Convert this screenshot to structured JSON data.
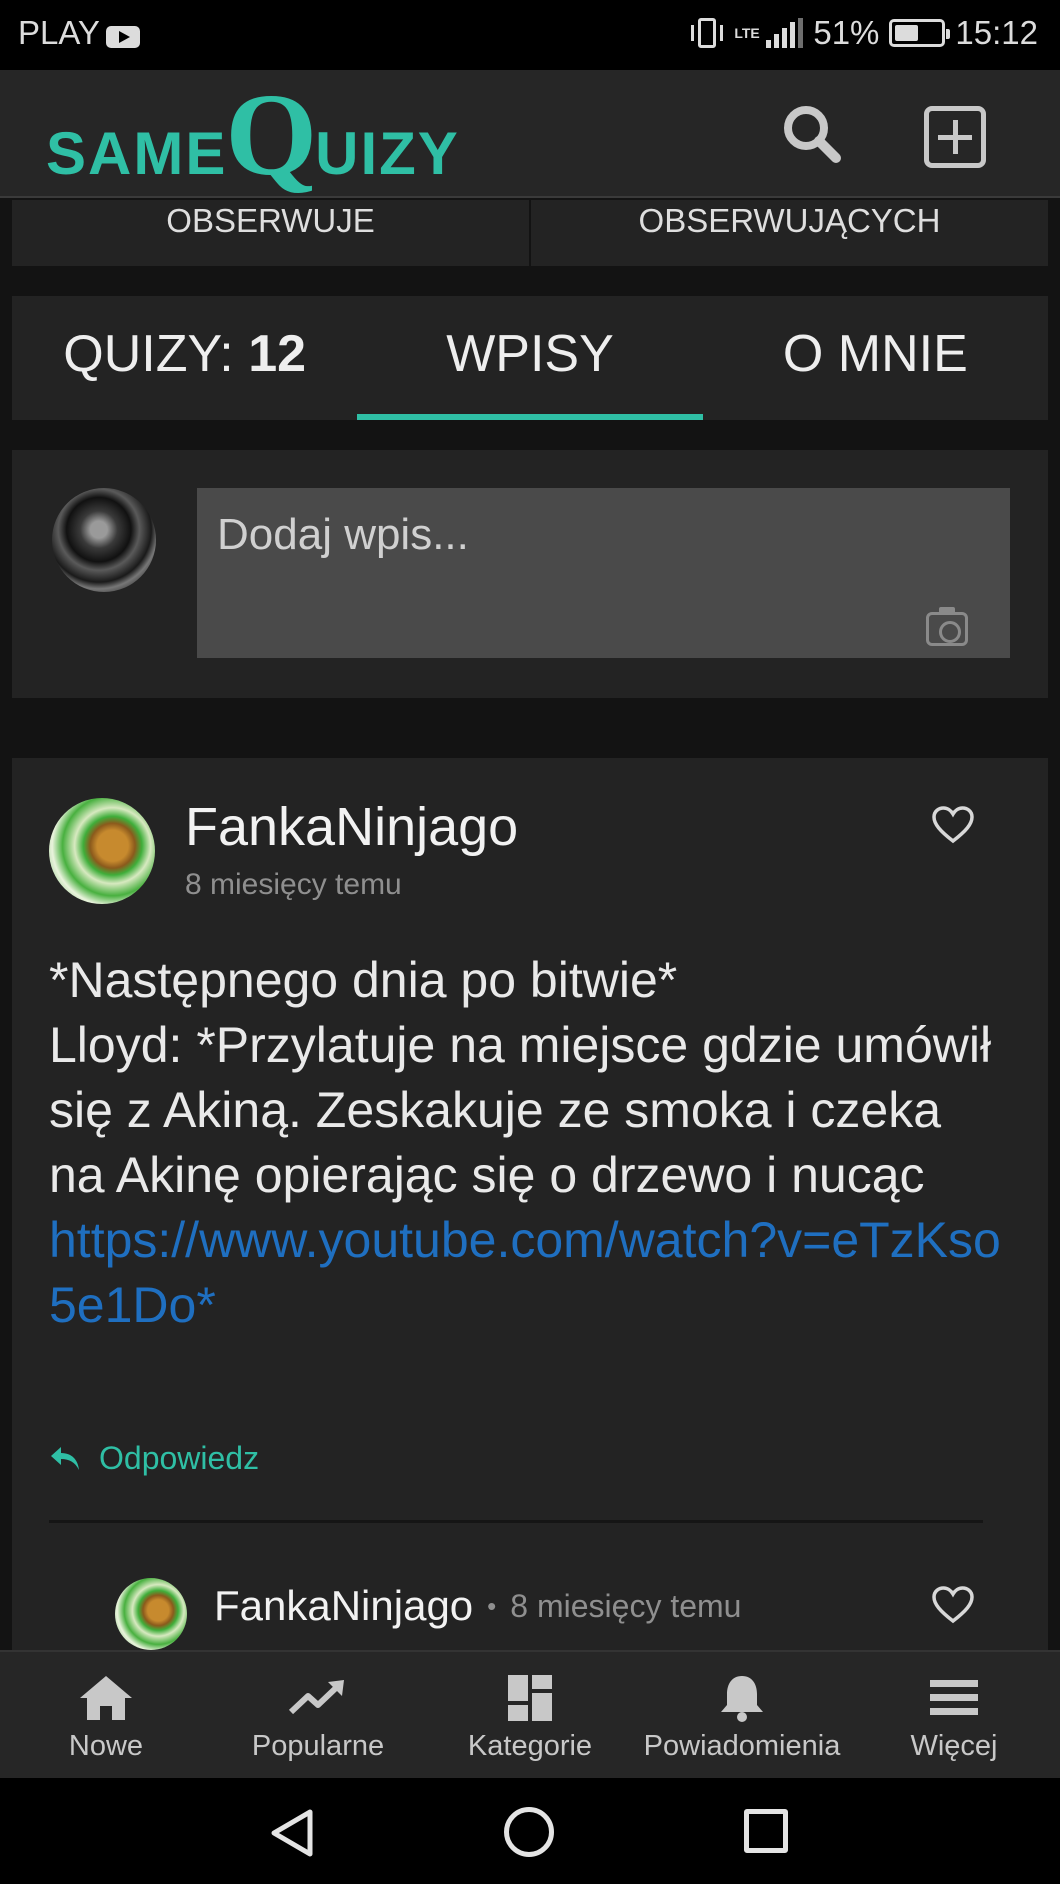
{
  "status_bar": {
    "carrier": "PLAY",
    "network": "LTE",
    "battery": "51%",
    "time": "15:12"
  },
  "header": {
    "logo_small_1": "SAME",
    "logo_big": "Q",
    "logo_small_2": "UIZY"
  },
  "follow_row": {
    "following_label": "OBSERWUJE",
    "followers_label": "OBSERWUJĄCYCH"
  },
  "tabs": {
    "quizzes_label": "QUIZY:",
    "quizzes_count": "12",
    "posts_label": "WPISY",
    "about_label": "O MNIE",
    "active": "WPISY"
  },
  "new_post": {
    "placeholder": "Dodaj wpis..."
  },
  "post": {
    "author": "FankaNinjago",
    "time": "8 miesięcy temu",
    "text_lines": [
      "*Następnego dnia po bitwie*",
      "Lloyd: *Przylatuje na miejsce gdzie umówił się z Akiną. Zeskakuje ze smoka i czeka na Akinę opierając się o drzewo i nucąc"
    ],
    "link": "https://www.youtube.com/watch?v=eTzKso5e1Do*",
    "reply_label": "Odpowiedz"
  },
  "comment": {
    "author": "FankaNinjago",
    "separator": "•",
    "time": "8 miesięcy temu"
  },
  "bottom_nav": {
    "items": [
      "Nowe",
      "Popularne",
      "Kategorie",
      "Powiadomienia",
      "Więcej"
    ]
  },
  "colors": {
    "accent": "#2fbfa5",
    "link": "#1f6fc0",
    "background": "#131313",
    "card": "#232323"
  }
}
